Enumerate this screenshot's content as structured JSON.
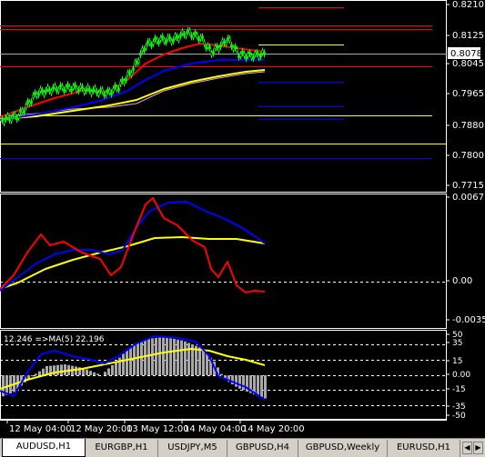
{
  "colors": {
    "bg": "#000000",
    "grid": "#ffffff",
    "candle": "#00ff00",
    "ma_red": "#ff0000",
    "ma_blue": "#0000ff",
    "ma_yellow": "#ffff00",
    "ma_violet": "#dda0dd",
    "level_red": "#ff0000",
    "level_blue": "#0000ff",
    "level_yellow": "#ffff00",
    "price_box_bg": "#ffffff",
    "tab_bg": "#d4d0c8"
  },
  "main_axis": {
    "labels": [
      "0.8210",
      "0.8125",
      "0.8078",
      "0.8045",
      "0.7965",
      "0.7880",
      "0.7800",
      "0.7715"
    ],
    "current_price": "0.8078"
  },
  "osc1_axis": {
    "labels": [
      "0.0067",
      "0.00",
      "-0.0035"
    ]
  },
  "osc2": {
    "legend": "12.246  =>MA(5)  22.196",
    "axis_labels": [
      "50",
      "35",
      "15",
      "0.00",
      "-15",
      "-35",
      "-50"
    ]
  },
  "time_axis": [
    "12 May 04:00",
    "12 May 20:00",
    "13 May 12:00",
    "14 May 04:00",
    "14 May 20:00"
  ],
  "tabs": [
    {
      "label": "AUDUSD,H1",
      "active": true
    },
    {
      "label": "EURGBP,H1",
      "active": false
    },
    {
      "label": "USDJPY,M5",
      "active": false
    },
    {
      "label": "GBPUSD,H4",
      "active": false
    },
    {
      "label": "GBPUSD,Weekly",
      "active": false
    },
    {
      "label": "EURUSD,H1",
      "active": false
    }
  ],
  "tab_nav": {
    "prev_icon": "left-arrow-icon",
    "next_icon": "right-arrow-icon"
  }
}
